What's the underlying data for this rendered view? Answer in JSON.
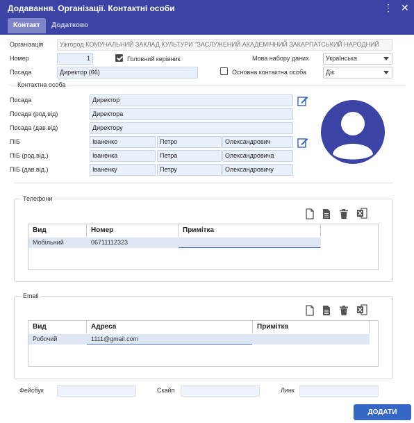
{
  "window": {
    "title": "Додавання. Організації. Контактні особи"
  },
  "tabs": [
    {
      "label": "Контакт"
    },
    {
      "label": "Додатково"
    }
  ],
  "form": {
    "org_label": "Організація",
    "org_value": "Ужгород КОМУНАЛЬНИЙ ЗАКЛАД КУЛЬТУРИ \"ЗАСЛУЖЕНИЙ АКАДЕМІЧНИЙ ЗАКАРПАТСЬКИЙ НАРОДНИЙ",
    "number_label": "Номер",
    "number_value": "1",
    "head_label": "Головний керівник",
    "head_checked": true,
    "lang_label": "Мова набору даних",
    "lang_value": "Українська",
    "position_label": "Посада",
    "position_value": "Директор (66)",
    "main_contact_label": "Основна контактна особа",
    "main_contact_checked": false,
    "status_value": "Діє"
  },
  "contact": {
    "legend": "Контактна особа",
    "pos_label": "Посада",
    "pos_value": "Директор",
    "pos_gen_label": "Посада (род.від)",
    "pos_gen_value": "Директора",
    "pos_dat_label": "Посада (дав.від)",
    "pos_dat_value": "Директору",
    "pib_label": "ПІБ",
    "pib": [
      "Іваненко",
      "Петро",
      "Олександрович"
    ],
    "pib_gen_label": "ПІБ (род.від.)",
    "pib_gen": [
      "Іваненка",
      "Петра",
      "Олександровича"
    ],
    "pib_dat_label": "ПІБ (дав.від.)",
    "pib_dat": [
      "Іваненку",
      "Петру",
      "Олександровичу"
    ]
  },
  "phones": {
    "legend": "Телефони",
    "columns": [
      "Вид",
      "Номер",
      "Примітка"
    ],
    "rows": [
      {
        "type": "Мобільний",
        "number": "06711112323",
        "note": ""
      }
    ]
  },
  "emails": {
    "legend": "Email",
    "columns": [
      "Вид",
      "Адреса",
      "Примітка"
    ],
    "rows": [
      {
        "type": "Робочий",
        "address": "1111@gmail.com",
        "note": ""
      }
    ]
  },
  "social": {
    "facebook_label": "Фейсбук",
    "skype_label": "Скайп",
    "link_label": "Линк"
  },
  "actions": {
    "add_label": "ДОДАТИ"
  },
  "colors": {
    "primary": "#3b44a4",
    "button": "#3568c6",
    "accent_icon": "#3b6bc4"
  }
}
